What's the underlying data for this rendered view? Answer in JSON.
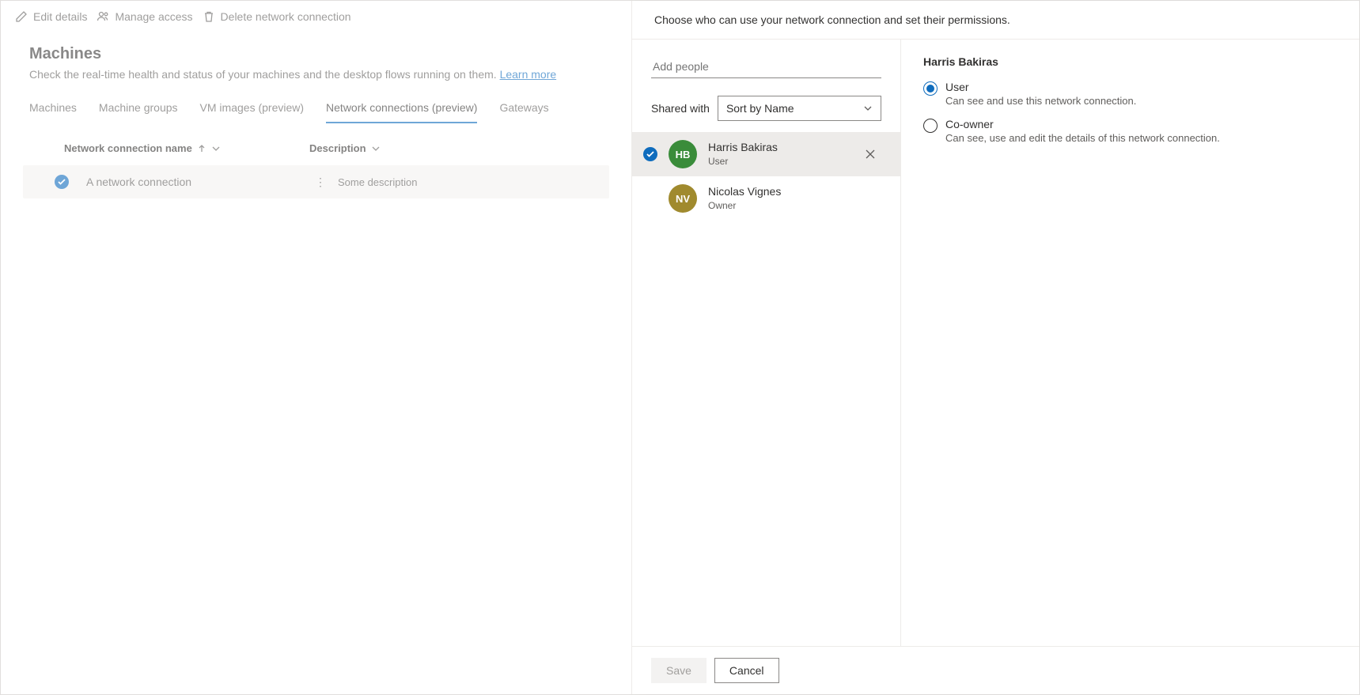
{
  "toolbar": {
    "edit": "Edit details",
    "manage": "Manage access",
    "delete": "Delete network connection"
  },
  "page": {
    "title": "Machines",
    "subtitle_prefix": "Check the real-time health and status of your machines and the desktop flows running on them. ",
    "learn_more": "Learn more"
  },
  "tabs": {
    "machines": "Machines",
    "groups": "Machine groups",
    "vmimages": "VM images (preview)",
    "network": "Network connections (preview)",
    "gateways": "Gateways"
  },
  "grid": {
    "col_name": "Network connection name",
    "col_desc": "Description",
    "row": {
      "name": "A network connection",
      "desc": "Some description"
    }
  },
  "panel": {
    "header": "Choose who can use your network connection and set their permissions.",
    "add_placeholder": "Add people",
    "shared_with": "Shared with",
    "sort": "Sort by Name",
    "people": [
      {
        "name": "Harris Bakiras",
        "role": "User",
        "initials": "HB",
        "selected": true,
        "avatarClass": "av-green"
      },
      {
        "name": "Nicolas Vignes",
        "role": "Owner",
        "initials": "NV",
        "selected": false,
        "avatarClass": "av-olive"
      }
    ],
    "detail_title": "Harris Bakiras",
    "perm_user": {
      "label": "User",
      "desc": "Can see and use this network connection."
    },
    "perm_coowner": {
      "label": "Co-owner",
      "desc": "Can see, use and edit the details of this network connection."
    },
    "save": "Save",
    "cancel": "Cancel"
  }
}
